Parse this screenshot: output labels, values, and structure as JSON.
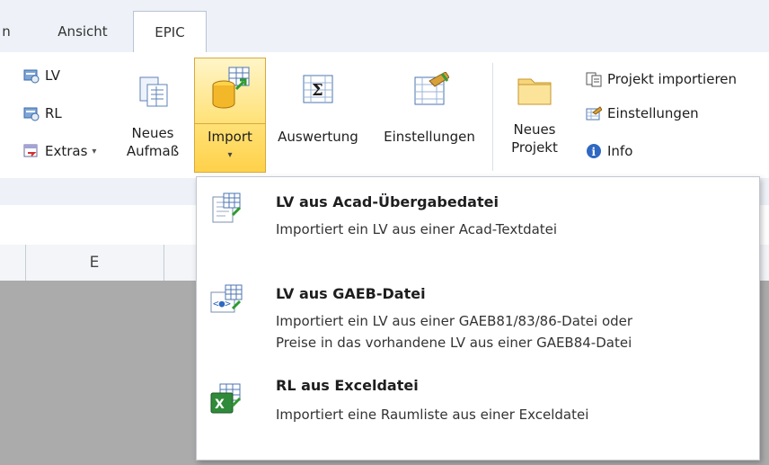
{
  "tabs": [
    {
      "label": "n"
    },
    {
      "label": "Ansicht"
    },
    {
      "label": "EPIC",
      "active": true
    }
  ],
  "ribbon": {
    "small_left": [
      "LV",
      "RL",
      "Extras"
    ],
    "big": {
      "neues_aufmass": [
        "Neues",
        "Aufmaß"
      ],
      "import": "Import",
      "auswertung": "Auswertung",
      "einstellungen": "Einstellungen",
      "neues_projekt": [
        "Neues",
        "Projekt"
      ]
    },
    "small_right": [
      "Projekt importieren",
      "Einstellungen",
      "Info"
    ]
  },
  "sheet": {
    "columns": [
      "E"
    ]
  },
  "dropdown": {
    "items": [
      {
        "title": "LV aus Acad-Übergabedatei",
        "desc": [
          "Importiert ein LV aus einer Acad-Textdatei"
        ]
      },
      {
        "title": "LV aus GAEB-Datei",
        "desc": [
          "Importiert ein LV aus einer GAEB81/83/86-Datei oder",
          "Preise in das vorhandene LV aus einer GAEB84-Datei"
        ]
      },
      {
        "title": "RL aus Exceldatei",
        "desc": [
          "Importiert eine Raumliste aus einer Exceldatei"
        ]
      }
    ]
  },
  "colors": {
    "accent": "#ffd14a",
    "sheet_bg": "#ababab"
  }
}
